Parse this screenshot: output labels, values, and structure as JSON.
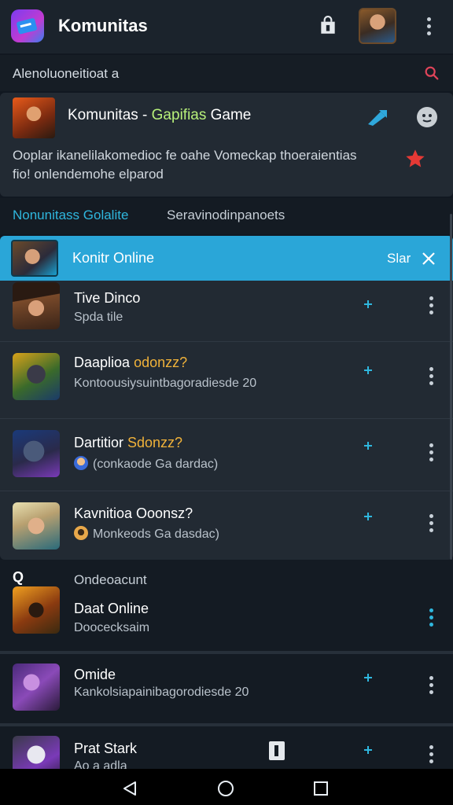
{
  "app": {
    "title": "Komunitas"
  },
  "search": {
    "placeholder": "Alenoluoneitioat a"
  },
  "community": {
    "title_part1": "Komunitas - ",
    "title_accent": "Gapifias",
    "title_part2": " Game",
    "description": "Ooplar ikanelilakomedioc fe oahe Vomeckap thoeraientias fio! onlendemohe elparod"
  },
  "tabs": [
    {
      "label": "Nonunitass Golalite"
    },
    {
      "label": "Seravinodinpanoets"
    }
  ],
  "highlight": {
    "title": "Konitr Online",
    "action": "Slar"
  },
  "items": [
    {
      "title": "Tive Dinco",
      "accent": "",
      "subtitle": "Spda tile"
    },
    {
      "title": "Daaplioa ",
      "accent": "odonzz?",
      "subtitle": "Kontoousiysuintbagoradiesde 20"
    },
    {
      "title": "Dartitior ",
      "accent": "Sdonzz?",
      "subtitle": "(conkaode Ga dardac)"
    },
    {
      "title": "Kavnitioa Ooonsz?",
      "accent": "",
      "subtitle": "Monkeods Ga dasdac)"
    }
  ],
  "section2": {
    "marker": "Q",
    "label": "Ondeoacunt",
    "items": [
      {
        "title": "Daat Online",
        "subtitle": "Doocecksaim"
      },
      {
        "title": "Omide",
        "subtitle": "Kankolsiapainibagorodiesde 20"
      },
      {
        "title": "Prat Stark",
        "subtitle": "Ao a adla"
      }
    ]
  },
  "colors": {
    "accent": "#2fb7de",
    "highlight_bg": "#2aa6d8",
    "background": "#111821",
    "card": "#222a33",
    "star": "#e53935"
  },
  "icons": [
    "app-logo-icon",
    "bag-icon",
    "kebab-icon",
    "search-icon",
    "share-icon",
    "emoji-icon",
    "star-icon",
    "close-icon",
    "plus-icon",
    "back-icon",
    "home-icon",
    "recent-icon"
  ]
}
